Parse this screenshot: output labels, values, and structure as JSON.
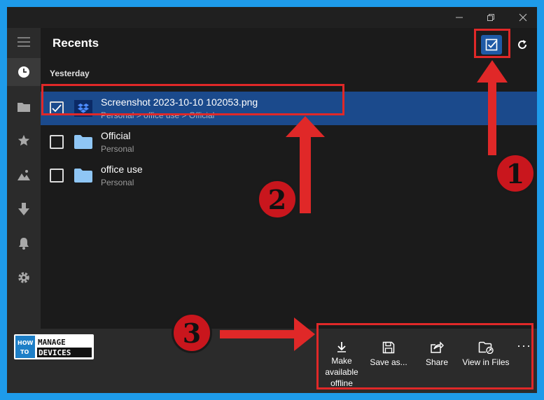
{
  "app": {
    "page_title": "Recents",
    "group_label": "Yesterday"
  },
  "window_controls": {
    "icons": [
      "minimize-icon",
      "restore-icon",
      "close-icon"
    ]
  },
  "sidebar": {
    "items": [
      {
        "name": "menu-icon"
      },
      {
        "name": "recents-clock-icon",
        "active": true
      },
      {
        "name": "folder-icon"
      },
      {
        "name": "star-icon"
      },
      {
        "name": "photos-icon"
      },
      {
        "name": "download-icon"
      },
      {
        "name": "bell-icon"
      },
      {
        "name": "settings-icon"
      }
    ]
  },
  "files": [
    {
      "name": "Screenshot 2023-10-10 102053.png",
      "path": "Personal > office use > Official",
      "icon": "dropbox-icon",
      "checked": true
    },
    {
      "name": "Official",
      "path": "Personal",
      "icon": "folder-icon",
      "checked": false
    },
    {
      "name": "office use",
      "path": "Personal",
      "icon": "folder-icon",
      "checked": false
    }
  ],
  "actions": {
    "offline_line1": "Make",
    "offline_line2": "available",
    "offline_line3": "offline",
    "save_as": "Save as...",
    "share": "Share",
    "view_in_files": "View in Files",
    "more": "···"
  },
  "logo": {
    "how": "HOW",
    "to": "TO",
    "manage": "MANAGE",
    "devices": "DEVICES"
  },
  "annotations": {
    "badge1": "1",
    "badge2": "2",
    "badge3": "3"
  },
  "colors": {
    "frame": "#1e9bea",
    "selected_row": "#1b4a8c",
    "annotation_red": "#e02828"
  }
}
